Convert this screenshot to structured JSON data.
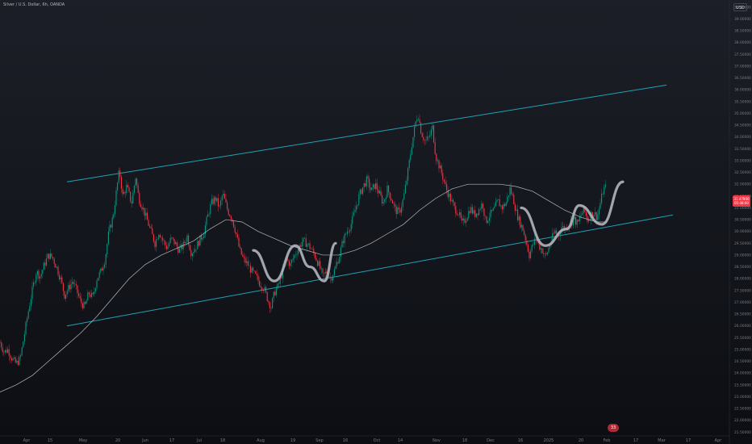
{
  "chart_data": {
    "type": "line",
    "title": "Silver / U.S. Dollar, 6h, OANDA",
    "currency": "USD",
    "last_price": "31.47800",
    "last_price_secondary": "05:48:00",
    "event_badge": "33",
    "ylim": [
      21.0,
      39.8
    ],
    "y_ticks": [
      "21.50000",
      "22.00000",
      "22.50000",
      "23.00000",
      "23.50000",
      "24.00000",
      "24.50000",
      "25.00000",
      "25.50000",
      "26.00000",
      "26.50000",
      "27.00000",
      "27.50000",
      "28.00000",
      "28.50000",
      "29.00000",
      "29.50000",
      "30.00000",
      "30.50000",
      "31.00000",
      "31.50000",
      "32.00000",
      "32.50000",
      "33.00000",
      "33.50000",
      "34.00000",
      "34.50000",
      "35.00000",
      "35.50000",
      "36.00000",
      "36.50000",
      "37.00000",
      "37.50000",
      "38.00000",
      "38.50000",
      "39.00000",
      "39.50000"
    ],
    "x_ticks": [
      "18",
      "Apr",
      "15",
      "May",
      "20",
      "Jun",
      "17",
      "Jul",
      "18",
      "Aug",
      "19",
      "Sep",
      "16",
      "Oct",
      "14",
      "Nov",
      "18",
      "Dec",
      "16",
      "2025",
      "20",
      "Feb",
      "17",
      "Mar",
      "17",
      "Apr"
    ],
    "x_tick_index": [
      -5,
      33,
      62,
      103,
      146,
      180,
      213,
      247,
      276,
      323,
      363,
      396,
      428,
      467,
      496,
      541,
      576,
      608,
      645,
      680,
      720,
      752,
      788,
      820,
      853,
      890
    ],
    "price_series": [
      [
        0,
        25.3
      ],
      [
        5,
        24.9
      ],
      [
        10,
        25.0
      ],
      [
        15,
        24.6
      ],
      [
        20,
        24.4
      ],
      [
        25,
        24.6
      ],
      [
        30,
        25.6
      ],
      [
        35,
        26.6
      ],
      [
        40,
        27.5
      ],
      [
        45,
        28.3
      ],
      [
        50,
        28.1
      ],
      [
        55,
        28.6
      ],
      [
        60,
        29.0
      ],
      [
        65,
        28.9
      ],
      [
        70,
        28.5
      ],
      [
        75,
        28.0
      ],
      [
        80,
        27.3
      ],
      [
        85,
        27.6
      ],
      [
        90,
        27.9
      ],
      [
        95,
        27.5
      ],
      [
        100,
        27.0
      ],
      [
        105,
        26.8
      ],
      [
        110,
        27.4
      ],
      [
        115,
        27.2
      ],
      [
        120,
        28.0
      ],
      [
        125,
        28.3
      ],
      [
        130,
        28.8
      ],
      [
        135,
        30.0
      ],
      [
        140,
        30.6
      ],
      [
        145,
        31.9
      ],
      [
        148,
        32.6
      ],
      [
        152,
        31.5
      ],
      [
        157,
        31.9
      ],
      [
        163,
        31.2
      ],
      [
        168,
        32.3
      ],
      [
        172,
        31.4
      ],
      [
        177,
        31.0
      ],
      [
        182,
        30.5
      ],
      [
        187,
        30.0
      ],
      [
        192,
        29.5
      ],
      [
        197,
        30.0
      ],
      [
        202,
        29.6
      ],
      [
        207,
        29.3
      ],
      [
        212,
        29.7
      ],
      [
        217,
        29.5
      ],
      [
        222,
        29.2
      ],
      [
        227,
        29.4
      ],
      [
        232,
        29.8
      ],
      [
        237,
        29.1
      ],
      [
        242,
        29.3
      ],
      [
        247,
        29.6
      ],
      [
        252,
        29.9
      ],
      [
        257,
        30.6
      ],
      [
        262,
        31.2
      ],
      [
        267,
        31.4
      ],
      [
        272,
        31.0
      ],
      [
        276,
        31.6
      ],
      [
        282,
        30.9
      ],
      [
        287,
        30.6
      ],
      [
        292,
        30.0
      ],
      [
        297,
        29.2
      ],
      [
        302,
        28.8
      ],
      [
        307,
        28.6
      ],
      [
        312,
        28.3
      ],
      [
        317,
        28.1
      ],
      [
        322,
        27.8
      ],
      [
        327,
        27.6
      ],
      [
        332,
        27.1
      ],
      [
        336,
        26.8
      ],
      [
        340,
        27.4
      ],
      [
        345,
        27.7
      ],
      [
        350,
        28.3
      ],
      [
        355,
        28.8
      ],
      [
        360,
        28.6
      ],
      [
        365,
        29.0
      ],
      [
        370,
        29.3
      ],
      [
        375,
        29.6
      ],
      [
        380,
        29.5
      ],
      [
        385,
        29.3
      ],
      [
        390,
        29.0
      ],
      [
        395,
        28.6
      ],
      [
        400,
        28.1
      ],
      [
        405,
        28.3
      ],
      [
        410,
        28.0
      ],
      [
        415,
        28.4
      ],
      [
        420,
        28.9
      ],
      [
        425,
        29.6
      ],
      [
        430,
        30.0
      ],
      [
        435,
        30.3
      ],
      [
        440,
        30.9
      ],
      [
        445,
        31.5
      ],
      [
        450,
        31.9
      ],
      [
        455,
        32.2
      ],
      [
        460,
        31.7
      ],
      [
        465,
        32.0
      ],
      [
        470,
        31.6
      ],
      [
        475,
        31.2
      ],
      [
        480,
        31.8
      ],
      [
        485,
        31.4
      ],
      [
        490,
        30.9
      ],
      [
        495,
        30.8
      ],
      [
        500,
        31.4
      ],
      [
        505,
        32.4
      ],
      [
        510,
        33.6
      ],
      [
        515,
        34.6
      ],
      [
        518,
        35.0
      ],
      [
        522,
        34.2
      ],
      [
        527,
        33.8
      ],
      [
        532,
        34.0
      ],
      [
        536,
        34.4
      ],
      [
        540,
        33.2
      ],
      [
        544,
        32.8
      ],
      [
        548,
        32.4
      ],
      [
        553,
        31.8
      ],
      [
        558,
        31.4
      ],
      [
        563,
        31.0
      ],
      [
        568,
        30.8
      ],
      [
        573,
        30.3
      ],
      [
        578,
        30.6
      ],
      [
        583,
        31.0
      ],
      [
        588,
        30.7
      ],
      [
        593,
        30.9
      ],
      [
        598,
        31.2
      ],
      [
        602,
        30.4
      ],
      [
        607,
        30.7
      ],
      [
        612,
        30.9
      ],
      [
        617,
        31.3
      ],
      [
        622,
        31.0
      ],
      [
        627,
        31.2
      ],
      [
        632,
        31.8
      ],
      [
        636,
        31.4
      ],
      [
        640,
        30.8
      ],
      [
        644,
        30.4
      ],
      [
        648,
        30.1
      ],
      [
        652,
        29.6
      ],
      [
        656,
        29.0
      ],
      [
        660,
        29.4
      ],
      [
        664,
        29.7
      ],
      [
        668,
        29.4
      ],
      [
        672,
        29.2
      ],
      [
        676,
        28.9
      ],
      [
        680,
        29.3
      ],
      [
        684,
        29.7
      ],
      [
        688,
        30.0
      ],
      [
        692,
        29.8
      ],
      [
        696,
        30.2
      ],
      [
        700,
        30.1
      ],
      [
        704,
        30.3
      ],
      [
        708,
        30.4
      ],
      [
        712,
        30.5
      ],
      [
        716,
        30.3
      ],
      [
        720,
        30.7
      ],
      [
        724,
        30.9
      ],
      [
        728,
        30.5
      ],
      [
        732,
        30.7
      ],
      [
        736,
        30.8
      ],
      [
        740,
        30.6
      ],
      [
        744,
        31.2
      ],
      [
        748,
        31.8
      ],
      [
        752,
        31.9
      ]
    ],
    "moving_average": [
      [
        0,
        23.2
      ],
      [
        20,
        23.5
      ],
      [
        40,
        23.9
      ],
      [
        60,
        24.5
      ],
      [
        80,
        25.1
      ],
      [
        100,
        25.7
      ],
      [
        120,
        26.4
      ],
      [
        140,
        27.2
      ],
      [
        160,
        28.0
      ],
      [
        180,
        28.6
      ],
      [
        200,
        29.0
      ],
      [
        220,
        29.3
      ],
      [
        240,
        29.6
      ],
      [
        260,
        30.1
      ],
      [
        280,
        30.5
      ],
      [
        300,
        30.4
      ],
      [
        320,
        30.0
      ],
      [
        340,
        29.7
      ],
      [
        360,
        29.4
      ],
      [
        380,
        29.2
      ],
      [
        400,
        29.0
      ],
      [
        420,
        29.0
      ],
      [
        440,
        29.2
      ],
      [
        460,
        29.5
      ],
      [
        480,
        29.9
      ],
      [
        500,
        30.3
      ],
      [
        520,
        30.9
      ],
      [
        540,
        31.4
      ],
      [
        560,
        31.8
      ],
      [
        580,
        32.0
      ],
      [
        600,
        32.0
      ],
      [
        620,
        32.0
      ],
      [
        640,
        31.9
      ],
      [
        660,
        31.7
      ],
      [
        680,
        31.3
      ],
      [
        700,
        30.9
      ],
      [
        720,
        30.6
      ],
      [
        740,
        30.4
      ],
      [
        752,
        30.4
      ]
    ],
    "channel_upper": [
      [
        83,
        32.1
      ],
      [
        826,
        36.2
      ]
    ],
    "channel_lower": [
      [
        83,
        26.0
      ],
      [
        834,
        30.7
      ]
    ],
    "pattern_left": [
      [
        314,
        29.2
      ],
      [
        340,
        27.9
      ],
      [
        366,
        29.4
      ],
      [
        384,
        28.5
      ],
      [
        402,
        27.9
      ],
      [
        416,
        29.5
      ]
    ],
    "pattern_right": [
      [
        646,
        31.0
      ],
      [
        676,
        29.4
      ],
      [
        702,
        30.1
      ],
      [
        718,
        31.1
      ],
      [
        746,
        30.3
      ],
      [
        772,
        32.1
      ]
    ],
    "colors": {
      "background": "#131722",
      "up_candle": "#089981",
      "down_candle": "#f23645",
      "channel": "#1fa3b5",
      "moving_average": "#d1d4dc",
      "pattern": "#b2b5be",
      "axis_text": "#787b86"
    }
  }
}
